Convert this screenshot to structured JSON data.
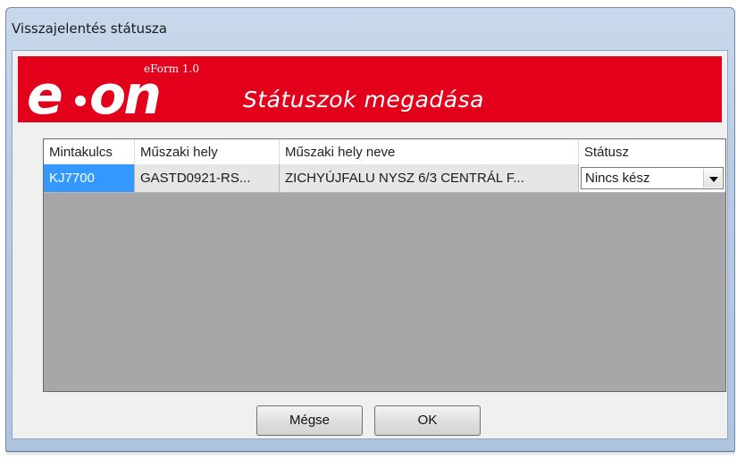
{
  "window": {
    "title": "Visszajelentés státusza"
  },
  "banner": {
    "logo_text": "e·on",
    "eform_version": "eForm 1.0",
    "title": "Státuszok megadása",
    "background_color": "#e2001a"
  },
  "grid": {
    "columns": [
      "Mintakulcs",
      "Műszaki hely",
      "Műszaki hely neve",
      "Státusz"
    ],
    "rows": [
      {
        "mintakulcs": "KJ7700",
        "muszaki_hely": "GASTD0921-RS...",
        "muszaki_hely_neve": "ZICHYÚJFALU NYSZ 6/3 CENTRÁL F...",
        "statusz": "Nincs kész"
      }
    ]
  },
  "buttons": {
    "cancel": "Mégse",
    "ok": "OK"
  }
}
